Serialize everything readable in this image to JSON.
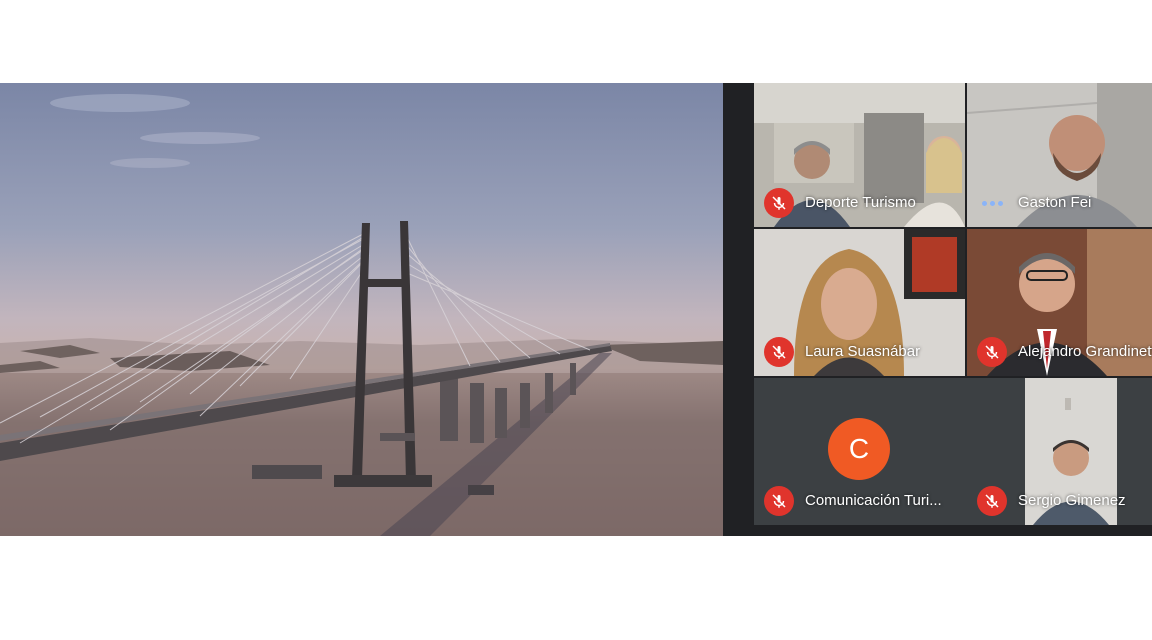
{
  "meeting": {
    "presentation": {
      "content": "bridge-video",
      "label": ""
    },
    "participants": [
      {
        "name": "Deporte Turismo",
        "status": "muted"
      },
      {
        "name": "Gaston Fei",
        "status": "speaking"
      },
      {
        "name": "Laura Suasnábar",
        "status": "muted"
      },
      {
        "name": "Alejandro Grandinetti",
        "status": "muted"
      },
      {
        "name": "Comunicación Turi...",
        "status": "muted",
        "avatar_letter": "C",
        "avatar_color": "#f05a24"
      },
      {
        "name": "Sergio Gimenez",
        "status": "muted"
      }
    ]
  },
  "colors": {
    "muted_badge": "#e0342c",
    "speaking_dots": "#8ab4f8",
    "background": "#202124"
  },
  "icons": [
    "mic-off-icon",
    "speaking-indicator-icon"
  ]
}
